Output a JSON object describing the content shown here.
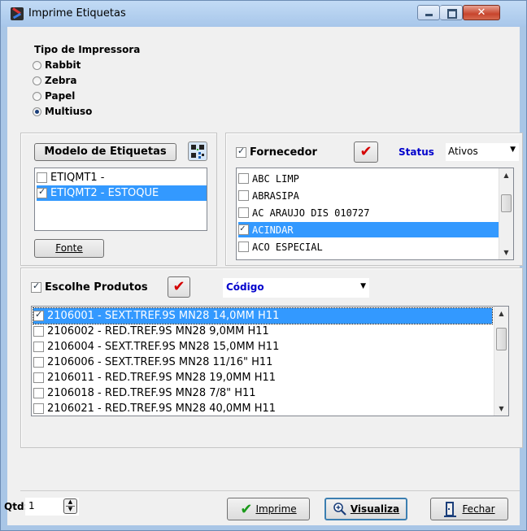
{
  "window": {
    "title": "Imprime Etiquetas",
    "controls": {
      "minimize": "–",
      "maximize": "□",
      "close": "✕"
    }
  },
  "printer_type": {
    "title": "Tipo de Impressora",
    "options": [
      {
        "label": "Rabbit",
        "selected": false
      },
      {
        "label": "Zebra",
        "selected": false
      },
      {
        "label": "Papel",
        "selected": false
      },
      {
        "label": "Multiuso",
        "selected": true
      }
    ]
  },
  "labels_model": {
    "button_label": "Modelo de Etiquetas",
    "items": [
      {
        "label": "ETIQMT1 -",
        "checked": false,
        "selected": false
      },
      {
        "label": "ETIQMT2 - ESTOQUE",
        "checked": true,
        "selected": true
      }
    ],
    "font_button": "Fonte"
  },
  "supplier": {
    "checkbox_label": "Fornecedor",
    "checked": true,
    "status_label": "Status",
    "status_value": "Ativos",
    "items": [
      {
        "label": "ABC LIMP",
        "checked": false,
        "selected": false
      },
      {
        "label": "ABRASIPA",
        "checked": false,
        "selected": false
      },
      {
        "label": "AC ARAUJO DIS 010727",
        "checked": false,
        "selected": false
      },
      {
        "label": "ACINDAR",
        "checked": true,
        "selected": true
      },
      {
        "label": "ACO ESPECIAL",
        "checked": false,
        "selected": false
      }
    ]
  },
  "products": {
    "checkbox_label": "Escolhe Produtos",
    "checked": true,
    "order_value": "Código",
    "items": [
      {
        "label": "2106001 - SEXT.TREF.9S MN28 14,0MM H11",
        "checked": true,
        "selected": true
      },
      {
        "label": "2106002 - RED.TREF.9S MN28 9,0MM H11",
        "checked": false,
        "selected": false
      },
      {
        "label": "2106004 - SEXT.TREF.9S MN28 15,0MM H11",
        "checked": false,
        "selected": false
      },
      {
        "label": "2106006 - SEXT.TREF.9S MN28 11/16\" H11",
        "checked": false,
        "selected": false
      },
      {
        "label": "2106011 - RED.TREF.9S MN28 19,0MM H11",
        "checked": false,
        "selected": false
      },
      {
        "label": "2106018 - RED.TREF.9S MN28 7/8\" H11",
        "checked": false,
        "selected": false
      },
      {
        "label": "2106021 - RED.TREF.9S MN28 40,0MM H11",
        "checked": false,
        "selected": false
      }
    ]
  },
  "footer": {
    "qty_label": "Qtd:",
    "qty_value": "1",
    "print_button": "Imprime",
    "preview_button": "Visualiza",
    "close_button": "Fechar"
  },
  "colors": {
    "accent": "#3399ff",
    "titlebar": "#a9c6e6",
    "link_blue": "#0000cc"
  },
  "icons": [
    "app-icon",
    "qr-icon",
    "red-check-icon",
    "green-check-icon",
    "magnifier-icon",
    "exit-door-icon",
    "spin-icon"
  ]
}
